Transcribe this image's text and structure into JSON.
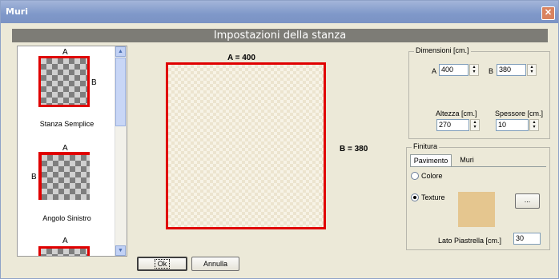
{
  "window": {
    "title": "Muri",
    "close_glyph": "✕"
  },
  "header": {
    "title": "Impostazioni della stanza"
  },
  "room_list": {
    "items": [
      {
        "label": "Stanza Semplice",
        "letter_a": "A",
        "letter_b": "B"
      },
      {
        "label": "Angolo Sinistro",
        "letter_a": "A",
        "letter_b": "B"
      },
      {
        "label": "",
        "letter_a": "A",
        "letter_b": ""
      }
    ]
  },
  "canvas": {
    "label_a": "A = 400",
    "label_b": "B = 380"
  },
  "dimensioni": {
    "title": "Dimensioni  [cm.]",
    "a_label": "A",
    "a_value": "400",
    "b_label": "B",
    "b_value": "380",
    "altezza_label": "Altezza [cm.]",
    "altezza_value": "270",
    "spessore_label": "Spessore [cm.]",
    "spessore_value": "10"
  },
  "finitura": {
    "title": "Finitura",
    "tabs": [
      "Pavimento",
      "Muri"
    ],
    "option_colore": "Colore",
    "option_texture": "Texture",
    "selected": "Texture",
    "browse_label": "...",
    "lato_label": "Lato Piastrella [cm.]",
    "lato_value": "30"
  },
  "buttons": {
    "ok": "Ok",
    "annulla": "Annulla"
  },
  "colors": {
    "room_border": "#e00000",
    "header": "#7d7c76",
    "texture": "#e5c68f"
  }
}
